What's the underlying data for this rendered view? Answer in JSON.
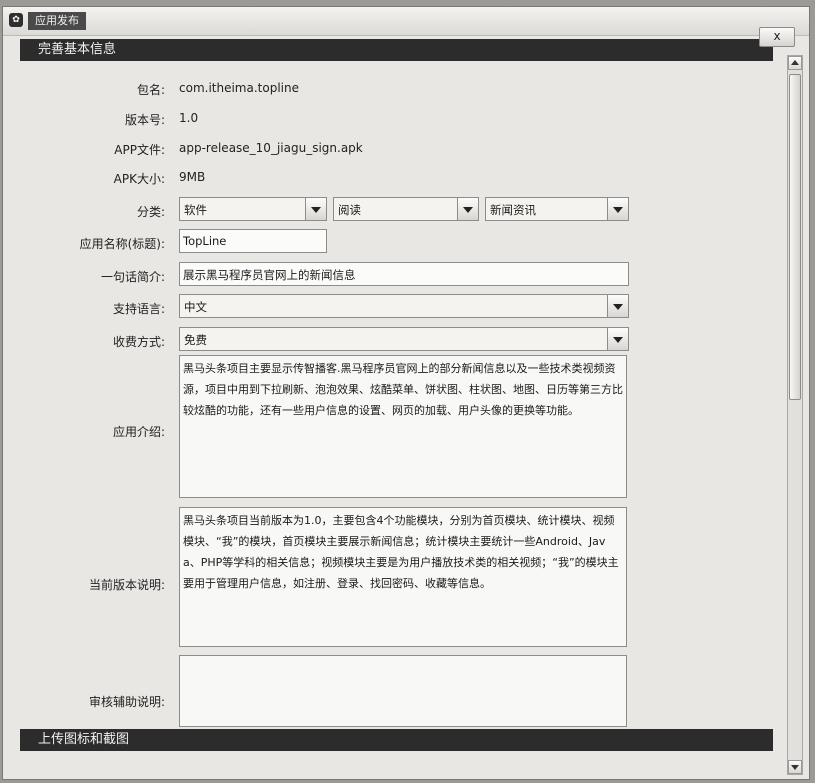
{
  "window": {
    "title": "应用发布",
    "close_label": "x"
  },
  "sections": {
    "basic_info": "完善基本信息",
    "upload": "上传图标和截图"
  },
  "fields": {
    "package": {
      "label": "包名:",
      "value": "com.itheima.topline"
    },
    "version": {
      "label": "版本号:",
      "value": "1.0"
    },
    "apk_file": {
      "label": "APP文件:",
      "value": "app-release_10_jiagu_sign.apk"
    },
    "apk_size": {
      "label": "APK大小:",
      "value": "9MB"
    },
    "category": {
      "label": "分类:",
      "level1": "软件",
      "level2": "阅读",
      "level3": "新闻资讯"
    },
    "app_name": {
      "label": "应用名称(标题):",
      "value": "TopLine"
    },
    "slogan": {
      "label": "一句话简介:",
      "value": "展示黑马程序员官网上的新闻信息"
    },
    "language": {
      "label": "支持语言:",
      "value": "中文"
    },
    "fee": {
      "label": "收费方式:",
      "value": "免费"
    },
    "intro": {
      "label": "应用介绍:",
      "value": "黑马头条项目主要显示传智播客.黑马程序员官网上的部分新闻信息以及一些技术类视频资源，项目中用到下拉刷新、泡泡效果、炫酷菜单、饼状图、柱状图、地图、日历等第三方比较炫酷的功能，还有一些用户信息的设置、网页的加载、用户头像的更换等功能。"
    },
    "version_notes": {
      "label": "当前版本说明:",
      "value": "黑马头条项目当前版本为1.0，主要包含4个功能模块，分别为首页模块、统计模块、视频模块、“我”的模块，首页模块主要展示新闻信息；统计模块主要统计一些Android、Java、PHP等学科的相关信息；视频模块主要是为用户播放技术类的相关视频；“我”的模块主要用于管理用户信息，如注册、登录、找回密码、收藏等信息。"
    },
    "review_notes": {
      "label": "审核辅助说明:",
      "value": ""
    }
  }
}
